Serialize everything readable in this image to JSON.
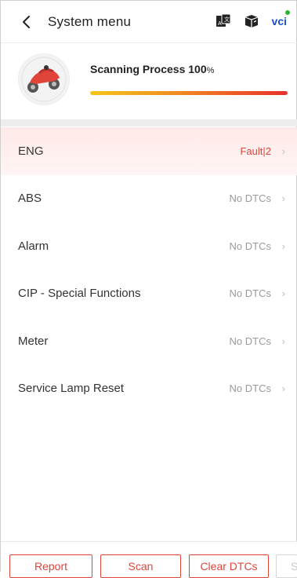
{
  "header": {
    "title": "System menu",
    "vci_label": "vci"
  },
  "scan": {
    "title": "Scanning Process 100",
    "percent_sign": "%",
    "progress": 1.0
  },
  "systems": [
    {
      "name": "ENG",
      "status": "Fault|2",
      "fault": true
    },
    {
      "name": "ABS",
      "status": "No DTCs",
      "fault": false
    },
    {
      "name": "Alarm",
      "status": "No DTCs",
      "fault": false
    },
    {
      "name": "CIP - Special Functions",
      "status": "No DTCs",
      "fault": false
    },
    {
      "name": "Meter",
      "status": "No DTCs",
      "fault": false
    },
    {
      "name": "Service Lamp Reset",
      "status": "No DTCs",
      "fault": false
    }
  ],
  "footer": {
    "report": "Report",
    "scan": "Scan",
    "clear_dtcs": "Clear DTCs",
    "partial": "S"
  },
  "colors": {
    "accent": "#e0443a",
    "vci_blue": "#1a4fd1",
    "vci_dot": "#2db32d"
  }
}
